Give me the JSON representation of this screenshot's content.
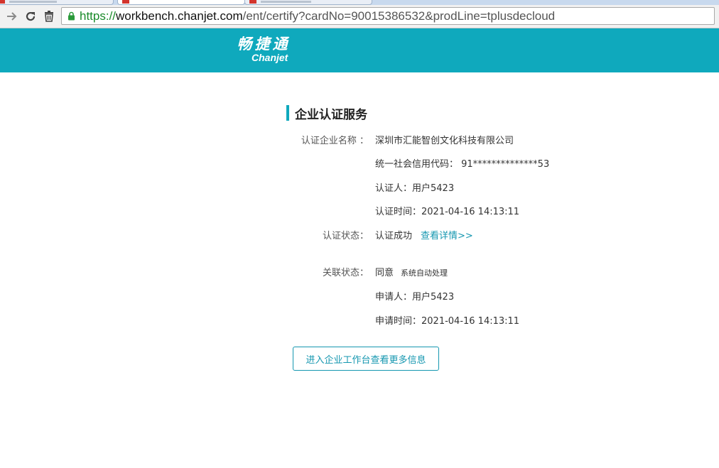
{
  "browser": {
    "url_scheme": "https://",
    "url_host": "workbench.chanjet.com",
    "url_rest": "/ent/certify?cardNo=90015386532&prodLine=tplusdecloud"
  },
  "brand": {
    "logo_cn": "畅捷通",
    "logo_en": "Chanjet",
    "color": "#0fa9bd"
  },
  "section": {
    "title": "企业认证服务"
  },
  "certification": {
    "company_label": "认证企业名称 ：",
    "company_name": "深圳市汇能智创文化科技有限公司",
    "credit_code": "统一社会信用代码： 91**************53",
    "certifier": "认证人：用户5423",
    "cert_time": "认证时间：2021-04-16 14:13:11",
    "status_label": "认证状态：",
    "status_value": "认证成功",
    "details_link": "查看详情>>"
  },
  "association": {
    "status_label": "关联状态：",
    "status_value": "同意",
    "status_note": "系统自动处理",
    "applicant": "申请人：用户5423",
    "apply_time": "申请时间：2021-04-16 14:13:11"
  },
  "actions": {
    "enter_workbench": "进入企业工作台查看更多信息"
  }
}
